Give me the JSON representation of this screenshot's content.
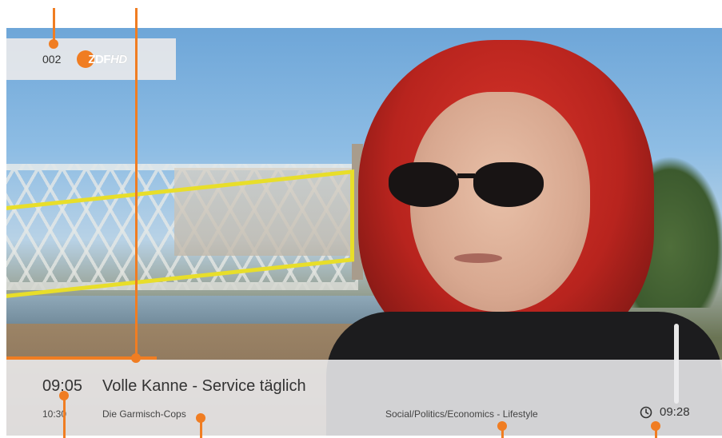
{
  "channel": {
    "number": "002",
    "logo_text": "ZDF",
    "logo_suffix": "HD"
  },
  "now": {
    "time": "09:05",
    "title": "Volle Kanne - Service täglich",
    "genre": "Social/Politics/Economics - Lifestyle",
    "progress_fraction": 0.21
  },
  "next": {
    "time": "10:30",
    "title": "Die Garmisch-Cops"
  },
  "clock": {
    "time": "09:28",
    "icon": "clock-icon"
  },
  "colors": {
    "accent": "#f07d22",
    "bar_bg": "#ececee",
    "text": "#333333"
  }
}
